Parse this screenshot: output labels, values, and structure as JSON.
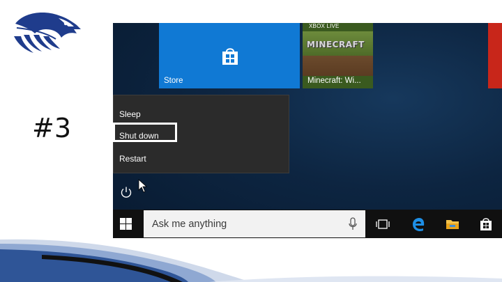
{
  "slide": {
    "number_label": "#3"
  },
  "colors": {
    "store_tile": "#1079d4",
    "desktop": "#0d2541",
    "menu_bg": "#2b2b2b",
    "taskbar": "#101010",
    "highlight_border": "#ffffff",
    "logo_blue": "#1f3c8c"
  },
  "tiles": [
    {
      "label": "Store",
      "icon": "store-bag-icon"
    },
    {
      "label": "Minecraft: Wi...",
      "badge": "XBOX LIVE",
      "art_text": "MINECRAFT",
      "icon": "minecraft-art"
    },
    {
      "label": "",
      "icon": "red-app-tile"
    }
  ],
  "power_menu": {
    "items": [
      {
        "label": "Sleep"
      },
      {
        "label": "Shut down",
        "highlighted": true
      },
      {
        "label": "Restart"
      }
    ]
  },
  "taskbar": {
    "search_placeholder": "Ask me anything",
    "icons": [
      "windows-start-icon",
      "microphone-icon",
      "task-view-icon",
      "edge-browser-icon",
      "file-explorer-icon",
      "store-icon"
    ]
  }
}
